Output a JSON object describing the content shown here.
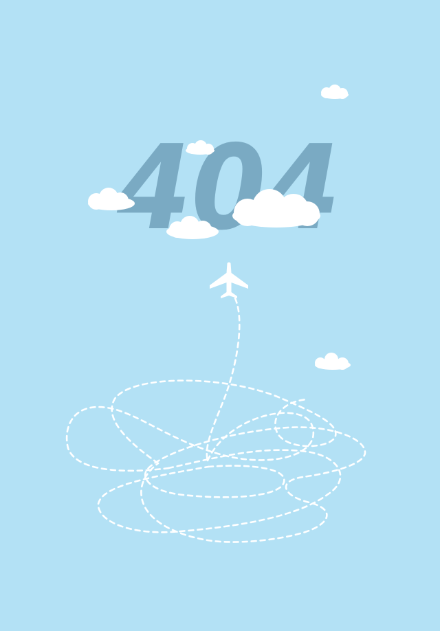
{
  "error": {
    "code": "404"
  },
  "colors": {
    "background": "#b3e1f5",
    "code_fill": "#7aaac3",
    "cloud": "#ffffff",
    "flight_path": "#ffffff",
    "airplane": "#ffffff"
  },
  "icons": {
    "airplane": "airplane-icon",
    "clouds": "cloud-icon",
    "path": "dashed-flight-path"
  }
}
